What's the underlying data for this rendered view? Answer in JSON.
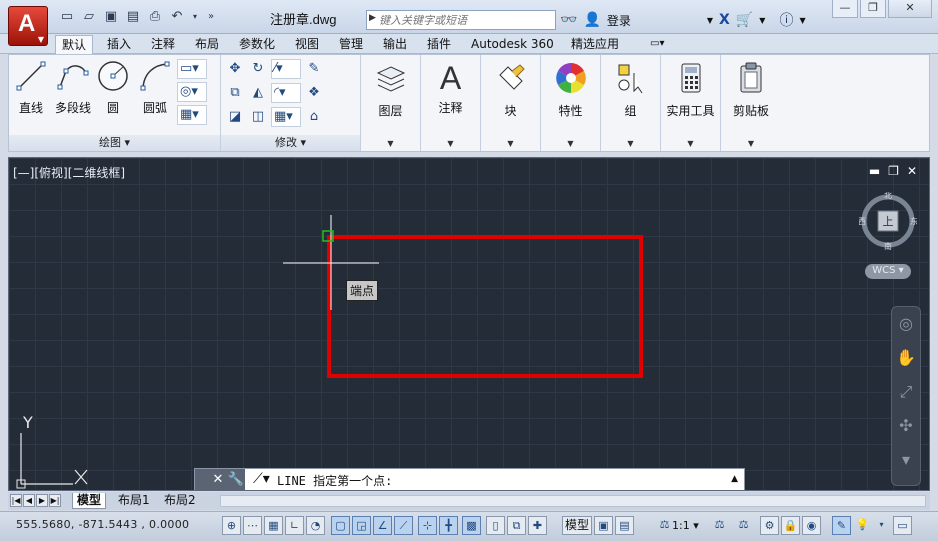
{
  "title_bar": {
    "document_title": "注册章.dwg",
    "search_placeholder": "键入关键字或短语",
    "login_label": "登录",
    "qat_icons": [
      "new-icon",
      "open-icon",
      "save-icon",
      "save-as-icon",
      "print-icon",
      "undo-icon",
      "undo-dropdown-icon",
      "more-icon"
    ]
  },
  "tabs": [
    "默认",
    "插入",
    "注释",
    "布局",
    "参数化",
    "视图",
    "管理",
    "输出",
    "插件",
    "Autodesk 360",
    "精选应用"
  ],
  "ribbon": {
    "draw_panel": {
      "label": "绘图",
      "big_tools": [
        "直线",
        "多段线",
        "圆",
        "圆弧"
      ]
    },
    "modify_panel": {
      "label": "修改"
    },
    "big_panels": [
      "图层",
      "注释",
      "块",
      "特性",
      "组",
      "实用工具",
      "剪贴板"
    ]
  },
  "viewport": {
    "view_label": "[—][俯视][二维线框]",
    "viewcube": {
      "north": "北",
      "south": "南",
      "east": "东",
      "west": "西",
      "face": "上"
    },
    "wcs_label": "WCS",
    "tooltip": "端点",
    "ucs_x": "X",
    "ucs_y": "Y",
    "rect_color": "#e00000"
  },
  "command_line": {
    "prompt": "LINE 指定第一个点:"
  },
  "layout_tabs": [
    "模型",
    "布局1",
    "布局2"
  ],
  "status_bar": {
    "coordinates": "555.5680,  -871.5443 , 0.0000",
    "model_label": "模型",
    "scale": "1:1"
  }
}
